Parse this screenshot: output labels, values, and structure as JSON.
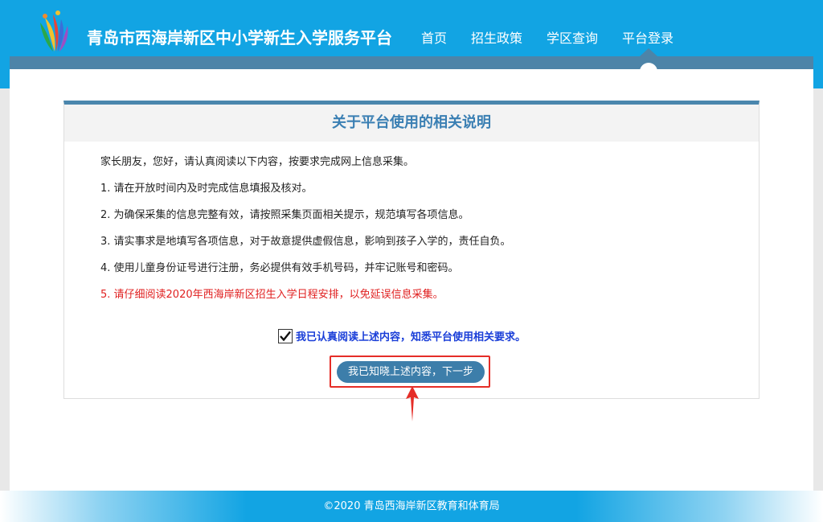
{
  "header": {
    "site_title": "青岛市西海岸新区中小学新生入学服务平台",
    "nav": [
      {
        "label": "首页"
      },
      {
        "label": "招生政策"
      },
      {
        "label": "学区查询"
      },
      {
        "label": "平台登录",
        "active": true
      }
    ]
  },
  "card": {
    "title": "关于平台使用的相关说明",
    "intro": "家长朋友，您好，请认真阅读以下内容，按要求完成网上信息采集。",
    "items": [
      "1. 请在开放时间内及时完成信息填报及核对。",
      "2. 为确保采集的信息完整有效，请按照采集页面相关提示，规范填写各项信息。",
      "3. 请实事求是地填写各项信息，对于故意提供虚假信息，影响到孩子入学的，责任自负。",
      "4. 使用儿童身份证号进行注册，务必提供有效手机号码，并牢记账号和密码。"
    ],
    "notice": "5. 请仔细阅读2020年西海岸新区招生入学日程安排，以免延误信息采集。",
    "agree_label": "我已认真阅读上述内容，知悉平台使用相关要求。",
    "agree_checked": true,
    "next_button": "我已知晓上述内容，下一步"
  },
  "footer": {
    "copyright": "©2020 青岛西海岸新区教育和体育局"
  },
  "colors": {
    "header_bg": "#12a4e3",
    "accent_blue": "#3d7eaa",
    "highlight_red": "#e52d27",
    "notice_red": "#e02020",
    "agree_text": "#1a3ed8"
  }
}
